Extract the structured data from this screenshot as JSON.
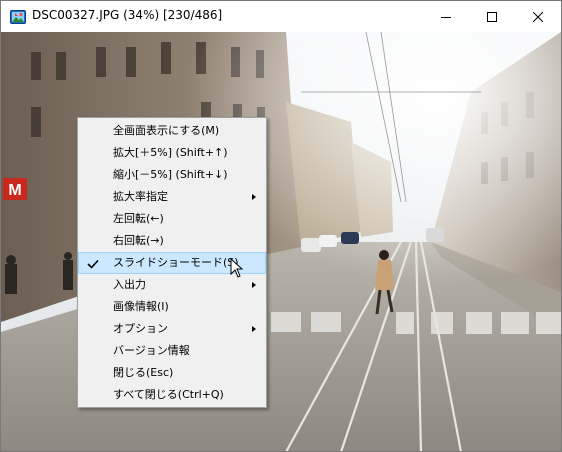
{
  "window": {
    "title": "DSC00327.JPG (34%)  [230/486]",
    "icon": "image-viewer-app-icon",
    "controls": [
      "minimize-icon",
      "maximize-icon",
      "close-icon"
    ]
  },
  "context_menu": {
    "items": [
      {
        "label": "全画面表示にする(M)",
        "submenu": false,
        "checked": false
      },
      {
        "label": "拡大[＋5%] (Shift+↑)",
        "submenu": false,
        "checked": false
      },
      {
        "label": "縮小[－5%] (Shift+↓)",
        "submenu": false,
        "checked": false
      },
      {
        "label": "拡大率指定",
        "submenu": true,
        "checked": false
      },
      {
        "label": "左回転(←)",
        "submenu": false,
        "checked": false
      },
      {
        "label": "右回転(→)",
        "submenu": false,
        "checked": false
      },
      {
        "label": "スライドショーモード(S)",
        "submenu": false,
        "checked": true,
        "highlighted": true
      },
      {
        "label": "入出力",
        "submenu": true,
        "checked": false
      },
      {
        "label": "画像情報(I)",
        "submenu": false,
        "checked": false
      },
      {
        "label": "オプション",
        "submenu": true,
        "checked": false
      },
      {
        "label": "バージョン情報",
        "submenu": false,
        "checked": false
      },
      {
        "label": "閉じる(Esc)",
        "submenu": false,
        "checked": false
      },
      {
        "label": "すべて閉じる(Ctrl+Q)",
        "submenu": false,
        "checked": false
      }
    ]
  },
  "photo": {
    "metro_sign": "M"
  },
  "colors": {
    "highlight_bg": "#cce8ff",
    "highlight_border": "#99d1ff",
    "menu_bg": "#f0f0f0"
  }
}
